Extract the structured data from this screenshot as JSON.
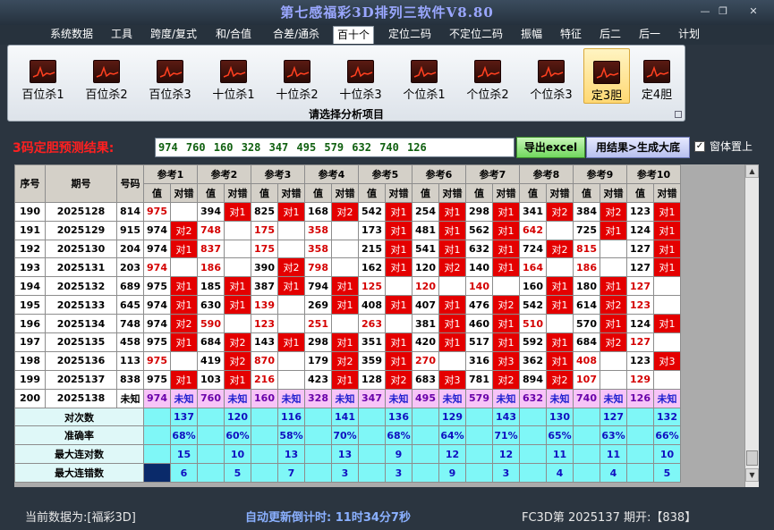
{
  "app": {
    "title": "第七感福彩3D排列三软件V8.80"
  },
  "window": {
    "minimize": "—",
    "restore": "❐",
    "close": "✕"
  },
  "menu": [
    "系统数据",
    "工具",
    "跨度/复式",
    "和/合值",
    "合差/通杀",
    "百十个",
    "定位二码",
    "不定位二码",
    "振幅",
    "特征",
    "后二",
    "后一",
    "计划"
  ],
  "menu_active": "百十个",
  "ribbon": {
    "items": [
      "百位杀1",
      "百位杀2",
      "百位杀3",
      "十位杀1",
      "十位杀2",
      "十位杀3",
      "个位杀1",
      "个位杀2",
      "个位杀3",
      "定3胆",
      "定4胆"
    ],
    "active": "定3胆",
    "caption": "请选择分析项目"
  },
  "prediction": {
    "label": "3码定胆预测结果:",
    "value": "974 760 160 328 347 495 579 632 740 126",
    "export": "导出excel",
    "generate": "用结果>生成大底",
    "on_top": "窗体置上",
    "on_top_checked": "✓"
  },
  "table": {
    "headers": {
      "seq": "序号",
      "period": "期号",
      "code": "号码",
      "refs": [
        "参考1",
        "参考2",
        "参考3",
        "参考4",
        "参考5",
        "参考6",
        "参考7",
        "参考8",
        "参考9",
        "参考10"
      ],
      "value": "值",
      "check": "对错"
    },
    "rows": [
      {
        "seq": "190",
        "period": "2025128",
        "code": "814",
        "cells": [
          [
            "975",
            "r",
            ""
          ],
          [
            "394",
            "v",
            "对1"
          ],
          [
            "825",
            "v",
            "对1"
          ],
          [
            "168",
            "v",
            "对2"
          ],
          [
            "542",
            "v",
            "对1"
          ],
          [
            "254",
            "v",
            "对1"
          ],
          [
            "298",
            "v",
            "对1"
          ],
          [
            "341",
            "v",
            "对2"
          ],
          [
            "384",
            "v",
            "对2"
          ],
          [
            "123",
            "v",
            "对1"
          ]
        ]
      },
      {
        "seq": "191",
        "period": "2025129",
        "code": "915",
        "cells": [
          [
            "974",
            "v",
            "对2"
          ],
          [
            "748",
            "r",
            ""
          ],
          [
            "175",
            "r",
            ""
          ],
          [
            "358",
            "r",
            ""
          ],
          [
            "173",
            "v",
            "对1"
          ],
          [
            "481",
            "v",
            "对1"
          ],
          [
            "562",
            "v",
            "对1"
          ],
          [
            "642",
            "r",
            ""
          ],
          [
            "725",
            "v",
            "对1"
          ],
          [
            "124",
            "v",
            "对1"
          ]
        ]
      },
      {
        "seq": "192",
        "period": "2025130",
        "code": "204",
        "cells": [
          [
            "974",
            "v",
            "对1"
          ],
          [
            "837",
            "r",
            ""
          ],
          [
            "175",
            "r",
            ""
          ],
          [
            "358",
            "r",
            ""
          ],
          [
            "215",
            "v",
            "对1"
          ],
          [
            "541",
            "v",
            "对1"
          ],
          [
            "632",
            "v",
            "对1"
          ],
          [
            "724",
            "v",
            "对2"
          ],
          [
            "815",
            "r",
            ""
          ],
          [
            "127",
            "v",
            "对1"
          ]
        ]
      },
      {
        "seq": "193",
        "period": "2025131",
        "code": "203",
        "cells": [
          [
            "974",
            "r",
            ""
          ],
          [
            "186",
            "r",
            ""
          ],
          [
            "390",
            "v",
            "对2"
          ],
          [
            "798",
            "r",
            ""
          ],
          [
            "162",
            "v",
            "对1"
          ],
          [
            "120",
            "v",
            "对2"
          ],
          [
            "140",
            "v",
            "对1"
          ],
          [
            "164",
            "r",
            ""
          ],
          [
            "186",
            "r",
            ""
          ],
          [
            "127",
            "v",
            "对1"
          ]
        ]
      },
      {
        "seq": "194",
        "period": "2025132",
        "code": "689",
        "cells": [
          [
            "975",
            "v",
            "对1"
          ],
          [
            "185",
            "v",
            "对1"
          ],
          [
            "387",
            "v",
            "对1"
          ],
          [
            "794",
            "v",
            "对1"
          ],
          [
            "125",
            "r",
            ""
          ],
          [
            "120",
            "r",
            ""
          ],
          [
            "140",
            "r",
            ""
          ],
          [
            "160",
            "v",
            "对1"
          ],
          [
            "180",
            "v",
            "对1"
          ],
          [
            "127",
            "r",
            ""
          ]
        ]
      },
      {
        "seq": "195",
        "period": "2025133",
        "code": "645",
        "cells": [
          [
            "974",
            "v",
            "对1"
          ],
          [
            "630",
            "v",
            "对1"
          ],
          [
            "139",
            "r",
            ""
          ],
          [
            "269",
            "v",
            "对1"
          ],
          [
            "408",
            "v",
            "对1"
          ],
          [
            "407",
            "v",
            "对1"
          ],
          [
            "476",
            "v",
            "对2"
          ],
          [
            "542",
            "v",
            "对1"
          ],
          [
            "614",
            "v",
            "对2"
          ],
          [
            "123",
            "r",
            ""
          ]
        ]
      },
      {
        "seq": "196",
        "period": "2025134",
        "code": "748",
        "cells": [
          [
            "974",
            "v",
            "对2"
          ],
          [
            "590",
            "r",
            ""
          ],
          [
            "123",
            "r",
            ""
          ],
          [
            "251",
            "r",
            ""
          ],
          [
            "263",
            "r",
            ""
          ],
          [
            "381",
            "v",
            "对1"
          ],
          [
            "460",
            "v",
            "对1"
          ],
          [
            "510",
            "r",
            ""
          ],
          [
            "570",
            "v",
            "对1"
          ],
          [
            "124",
            "v",
            "对1"
          ]
        ]
      },
      {
        "seq": "197",
        "period": "2025135",
        "code": "458",
        "cells": [
          [
            "975",
            "v",
            "对1"
          ],
          [
            "684",
            "v",
            "对2"
          ],
          [
            "143",
            "v",
            "对1"
          ],
          [
            "298",
            "v",
            "对1"
          ],
          [
            "351",
            "v",
            "对1"
          ],
          [
            "420",
            "v",
            "对1"
          ],
          [
            "517",
            "v",
            "对1"
          ],
          [
            "592",
            "v",
            "对1"
          ],
          [
            "684",
            "v",
            "对2"
          ],
          [
            "127",
            "r",
            ""
          ]
        ]
      },
      {
        "seq": "198",
        "period": "2025136",
        "code": "113",
        "cells": [
          [
            "975",
            "r",
            ""
          ],
          [
            "419",
            "v",
            "对2"
          ],
          [
            "870",
            "r",
            ""
          ],
          [
            "179",
            "v",
            "对2"
          ],
          [
            "359",
            "v",
            "对1"
          ],
          [
            "270",
            "r",
            ""
          ],
          [
            "316",
            "v",
            "对3"
          ],
          [
            "362",
            "v",
            "对1"
          ],
          [
            "408",
            "r",
            ""
          ],
          [
            "123",
            "v",
            "对3"
          ]
        ]
      },
      {
        "seq": "199",
        "period": "2025137",
        "code": "838",
        "cells": [
          [
            "975",
            "v",
            "对1"
          ],
          [
            "103",
            "v",
            "对1"
          ],
          [
            "216",
            "r",
            ""
          ],
          [
            "423",
            "v",
            "对1"
          ],
          [
            "128",
            "v",
            "对2"
          ],
          [
            "683",
            "v",
            "对3"
          ],
          [
            "781",
            "v",
            "对2"
          ],
          [
            "894",
            "v",
            "对2"
          ],
          [
            "107",
            "r",
            ""
          ],
          [
            "129",
            "r",
            ""
          ]
        ]
      }
    ],
    "current": {
      "seq": "200",
      "period": "2025138",
      "code": "未知",
      "values": [
        "974",
        "760",
        "160",
        "328",
        "347",
        "495",
        "579",
        "632",
        "740",
        "126"
      ],
      "status": "未知"
    },
    "summary": [
      {
        "label": "对次数",
        "values": [
          "137",
          "120",
          "116",
          "141",
          "136",
          "129",
          "143",
          "130",
          "127",
          "132"
        ]
      },
      {
        "label": "准确率",
        "values": [
          "68%",
          "60%",
          "58%",
          "70%",
          "68%",
          "64%",
          "71%",
          "65%",
          "63%",
          "66%"
        ]
      },
      {
        "label": "最大连对数",
        "values": [
          "15",
          "10",
          "13",
          "13",
          "9",
          "12",
          "12",
          "11",
          "11",
          "10"
        ]
      },
      {
        "label": "最大连错数",
        "values": [
          "6",
          "5",
          "7",
          "3",
          "3",
          "9",
          "3",
          "4",
          "4",
          "5"
        ]
      }
    ]
  },
  "status": {
    "left": "当前数据为:[福彩3D]",
    "middle": "自动更新倒计时: 11时34分7秒",
    "right": "FC3D第 2025137 期开:【838】"
  }
}
